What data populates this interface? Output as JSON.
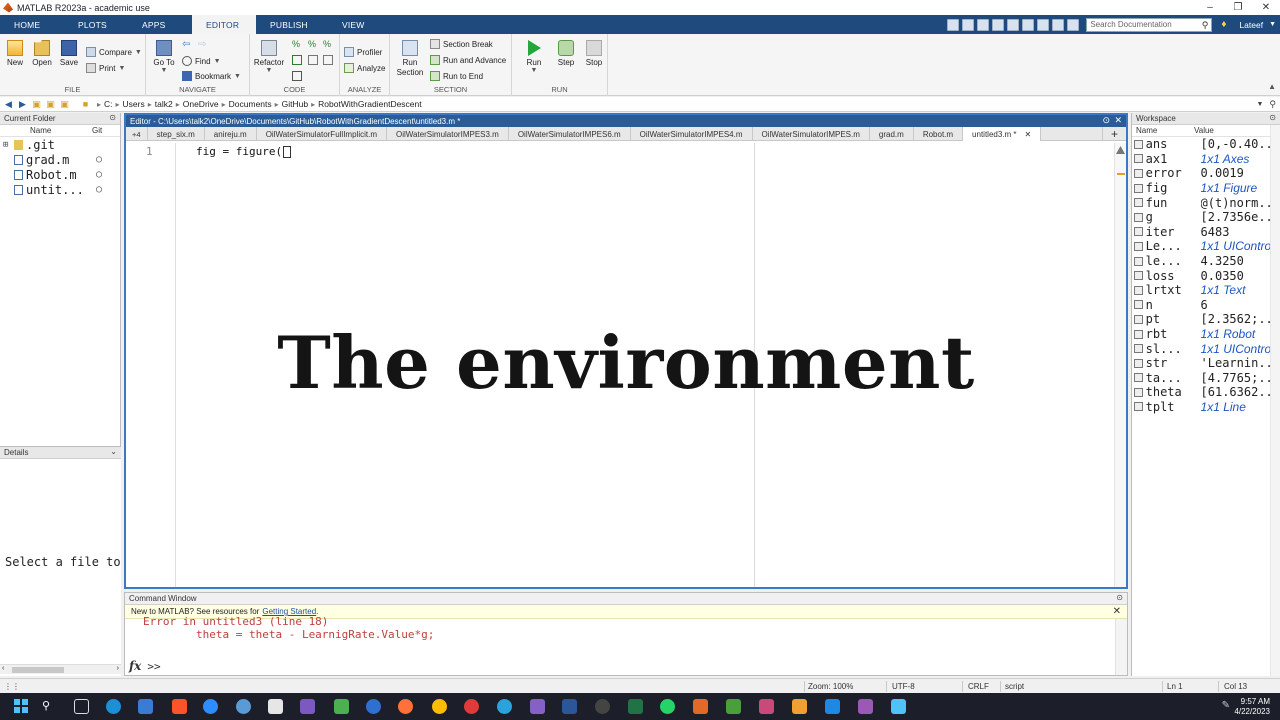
{
  "window": {
    "title": "MATLAB R2023a - academic use"
  },
  "ribbon_tabs": [
    {
      "label": "HOME",
      "active": false
    },
    {
      "label": "PLOTS",
      "active": false
    },
    {
      "label": "APPS",
      "active": false
    },
    {
      "label": "EDITOR",
      "active": true
    },
    {
      "label": "PUBLISH",
      "active": false
    },
    {
      "label": "VIEW",
      "active": false
    }
  ],
  "search": {
    "placeholder": "Search Documentation"
  },
  "user": {
    "name": "Lateef"
  },
  "toolstrip": {
    "file": {
      "title": "FILE",
      "new": "New",
      "open": "Open",
      "save": "Save",
      "compare": "Compare",
      "print": "Print"
    },
    "navigate": {
      "title": "NAVIGATE",
      "goto": "Go To",
      "find": "Find",
      "bookmark": "Bookmark"
    },
    "code": {
      "title": "CODE",
      "refactor": "Refactor"
    },
    "analyze": {
      "title": "ANALYZE",
      "profiler": "Profiler",
      "analyze": "Analyze"
    },
    "section": {
      "title": "SECTION",
      "run_section": "Run Section",
      "section_break": "Section Break",
      "run_advance": "Run and Advance",
      "run_to_end": "Run to End"
    },
    "run": {
      "title": "RUN",
      "run": "Run",
      "step": "Step",
      "stop": "Stop"
    }
  },
  "address": {
    "crumbs": [
      "C:",
      "Users",
      "talk2",
      "OneDrive",
      "Documents",
      "GitHub",
      "RobotWithGradientDescent"
    ]
  },
  "current_folder": {
    "title": "Current Folder",
    "col_name": "Name",
    "col_git": "Git",
    "files": [
      {
        "name": ".git",
        "kind": "folder"
      },
      {
        "name": "grad.m",
        "kind": "m"
      },
      {
        "name": "Robot.m",
        "kind": "m"
      },
      {
        "name": "untit...",
        "kind": "m"
      }
    ]
  },
  "details": {
    "title": "Details",
    "hint": "Select a file to"
  },
  "editor": {
    "title": "Editor - C:\\Users\\talk2\\OneDrive\\Documents\\GitHub\\RobotWithGradientDescent\\untitled3.m *",
    "tab_count": "+4",
    "tabs": [
      {
        "label": "step_six.m",
        "active": false
      },
      {
        "label": "anireju.m",
        "active": false
      },
      {
        "label": "OilWaterSimulatorFullImplicit.m",
        "active": false
      },
      {
        "label": "OilWaterSimulatorIMPES3.m",
        "active": false
      },
      {
        "label": "OilWaterSimulatorIMPES6.m",
        "active": false
      },
      {
        "label": "OilWaterSimulatorIMPES4.m",
        "active": false
      },
      {
        "label": "OilWaterSimulatorIMPES.m",
        "active": false
      },
      {
        "label": "grad.m",
        "active": false
      },
      {
        "label": "Robot.m",
        "active": false
      },
      {
        "label": "untitled3.m *",
        "active": true
      }
    ],
    "line_number": "1",
    "code_line": "fig = figure(",
    "overlay_text": "The environment"
  },
  "workspace": {
    "title": "Workspace",
    "col_name": "Name",
    "col_value": "Value",
    "vars": [
      {
        "name": "ans",
        "value": "[0,-0.40...",
        "obj": false
      },
      {
        "name": "ax1",
        "value": "1x1 Axes",
        "obj": true
      },
      {
        "name": "error",
        "value": "0.0019",
        "obj": false
      },
      {
        "name": "fig",
        "value": "1x1 Figure",
        "obj": true
      },
      {
        "name": "fun",
        "value": "@(t)norm...",
        "obj": false
      },
      {
        "name": "g",
        "value": "[2.7356e...",
        "obj": false
      },
      {
        "name": "iter",
        "value": "6483",
        "obj": false
      },
      {
        "name": "Le...",
        "value": "1x1 UIControl",
        "obj": true
      },
      {
        "name": "le...",
        "value": "4.3250",
        "obj": false
      },
      {
        "name": "loss",
        "value": "0.0350",
        "obj": false
      },
      {
        "name": "lrtxt",
        "value": "1x1 Text",
        "obj": true
      },
      {
        "name": "n",
        "value": "6",
        "obj": false
      },
      {
        "name": "pt",
        "value": "[2.3562;...",
        "obj": false
      },
      {
        "name": "rbt",
        "value": "1x1 Robot",
        "obj": true
      },
      {
        "name": "sl...",
        "value": "1x1 UIControl",
        "obj": true
      },
      {
        "name": "str",
        "value": "'Learnin...",
        "obj": false
      },
      {
        "name": "ta...",
        "value": "[4.7765;...",
        "obj": false
      },
      {
        "name": "theta",
        "value": "[61.6362...",
        "obj": false
      },
      {
        "name": "tplt",
        "value": "1x1 Line",
        "obj": true
      }
    ]
  },
  "command_window": {
    "title": "Command Window",
    "new_msg": "New to MATLAB? See resources for",
    "new_msg_link": "Getting Started",
    "new_msg_end": ".",
    "lines": [
      "Error in untitled3 (line 18)",
      "        theta = theta - LearnigRate.Value*g;"
    ],
    "fx": "fx",
    "prompt": ">>"
  },
  "statusbar": {
    "zoom": "Zoom: 100%",
    "encoding": "UTF-8",
    "eol": "CRLF",
    "type": "script",
    "ln": "Ln  1",
    "col": "Col  13"
  },
  "taskbar": {
    "time": "9:57 AM",
    "date": "4/22/2023"
  },
  "colors": {
    "ribbon_blue": "#1e4a7d",
    "editor_border": "#3c78c8",
    "object_value": "#1f55c4",
    "run_green": "#23a63a"
  }
}
